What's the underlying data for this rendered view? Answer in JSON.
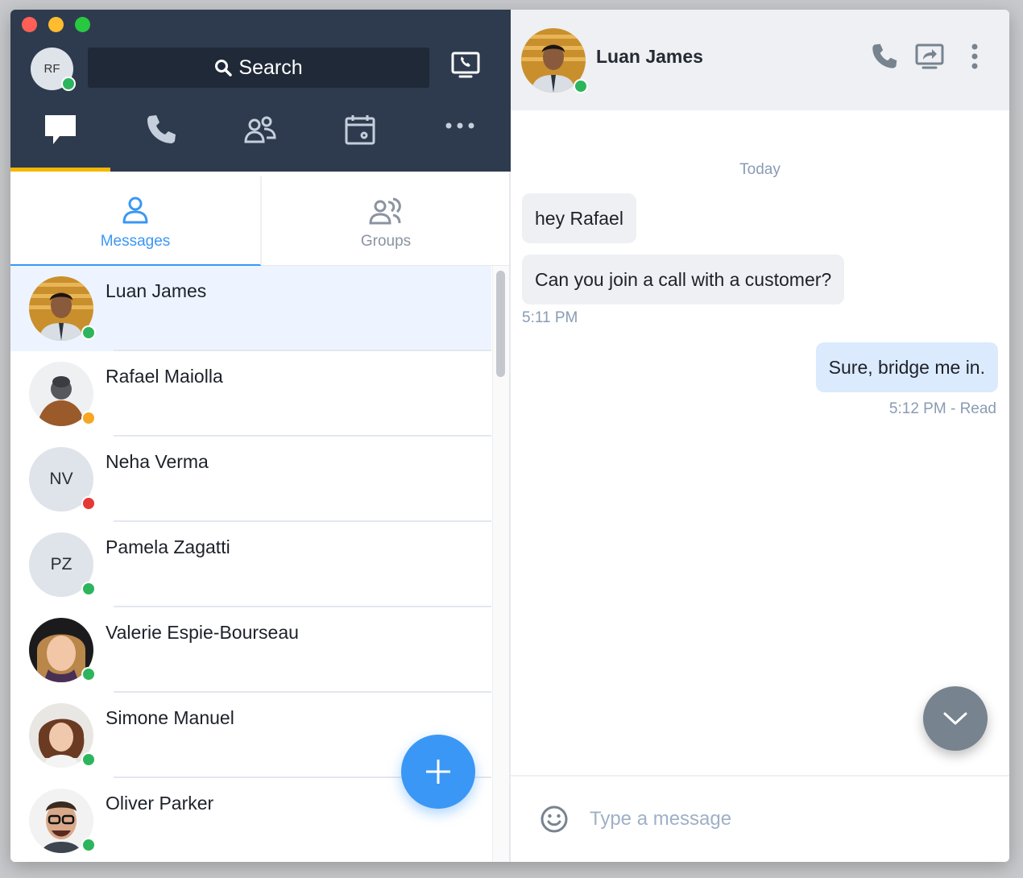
{
  "me": {
    "initials": "RF",
    "status": "online"
  },
  "search": {
    "label": "Search"
  },
  "nav": {
    "tabs": [
      {
        "name": "messages",
        "icon": "chat-bubble-icon",
        "active": true
      },
      {
        "name": "calls",
        "icon": "phone-icon",
        "active": false
      },
      {
        "name": "contacts",
        "icon": "contacts-icon",
        "active": false
      },
      {
        "name": "calendar",
        "icon": "calendar-icon",
        "active": false
      },
      {
        "name": "more",
        "icon": "more-horizontal-icon",
        "active": false
      }
    ]
  },
  "subtabs": {
    "messages": "Messages",
    "groups": "Groups"
  },
  "contacts": [
    {
      "name": "Luan James",
      "status": "online",
      "selected": true
    },
    {
      "name": "Rafael Maiolla",
      "status": "away"
    },
    {
      "name": "Neha Verma",
      "initials": "NV",
      "status": "busy"
    },
    {
      "name": "Pamela Zagatti",
      "initials": "PZ",
      "status": "online"
    },
    {
      "name": "Valerie Espie-Bourseau",
      "status": "online"
    },
    {
      "name": "Simone Manuel",
      "status": "online"
    },
    {
      "name": "Oliver Parker",
      "status": "online"
    }
  ],
  "chat": {
    "name": "Luan James",
    "status": "online",
    "day": "Today",
    "messages": [
      {
        "direction": "in",
        "text": "hey Rafael"
      },
      {
        "direction": "in",
        "text": "Can you join a call with a customer?",
        "time": "5:11 PM"
      },
      {
        "direction": "out",
        "text": "Sure, bridge me in.",
        "time": "5:12 PM - Read"
      }
    ],
    "composer_placeholder": "Type a message"
  },
  "colors": {
    "sidebar_bg": "#2e3b4e",
    "accent": "#3a97f5",
    "nav_active": "#f5b800",
    "online": "#2db55d",
    "away": "#f5a623",
    "busy": "#e53935"
  }
}
